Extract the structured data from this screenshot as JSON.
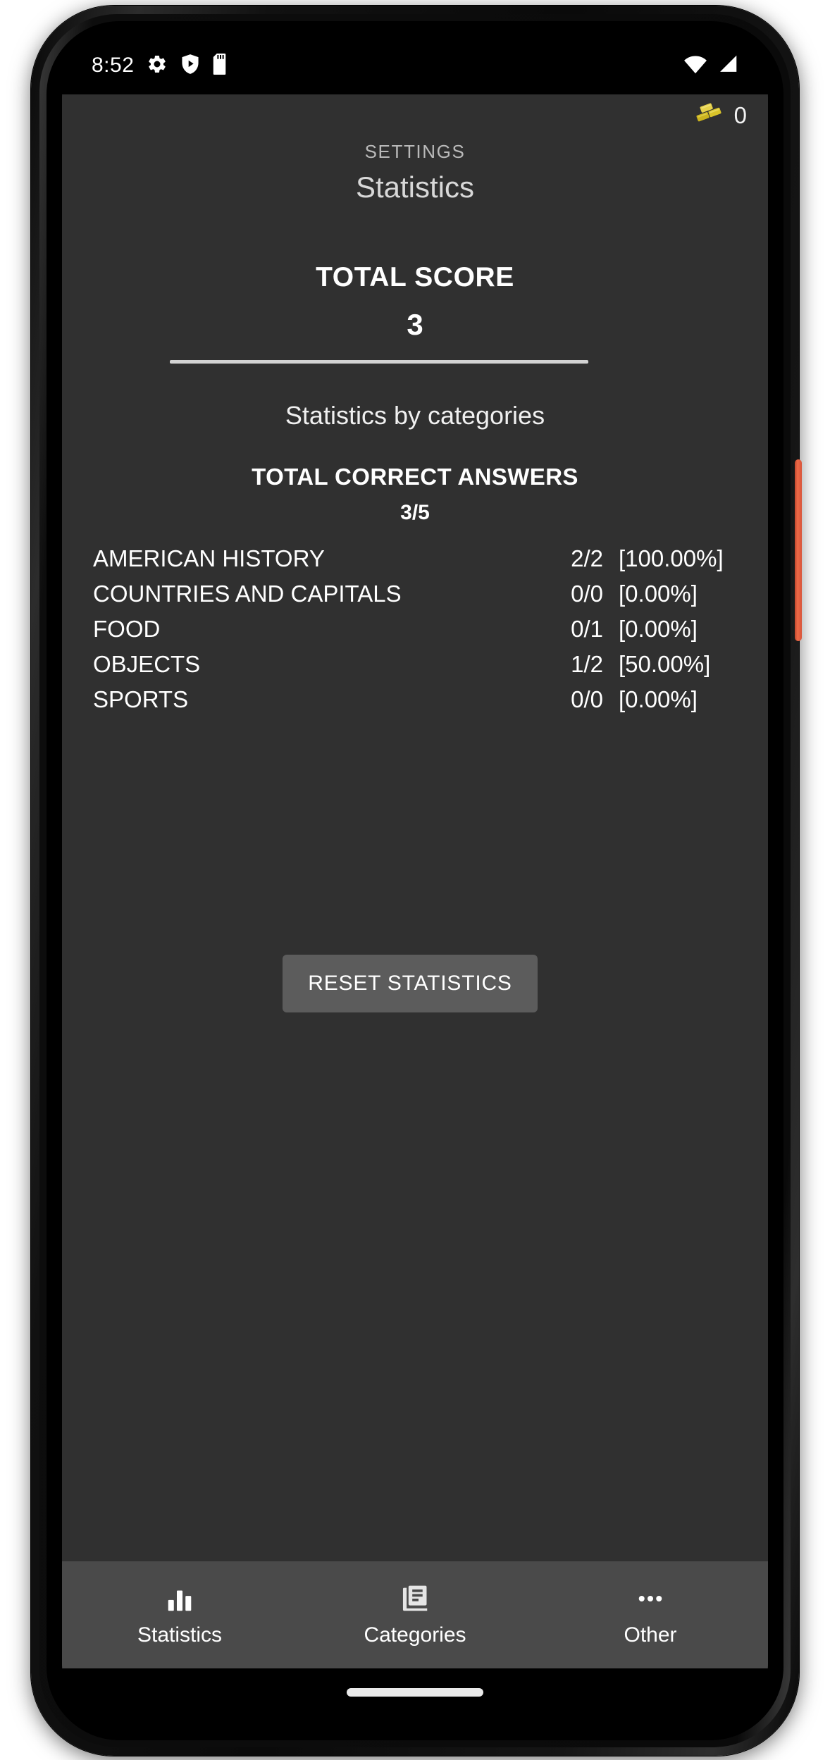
{
  "status_bar": {
    "time": "8:52",
    "left_icons": [
      "gear-icon",
      "shield-play-icon",
      "sd-card-icon"
    ],
    "right_icons": [
      "wifi-icon",
      "cellular-signal-icon"
    ]
  },
  "app": {
    "currency": {
      "icon": "gold-bars-icon",
      "count": "0",
      "color": "#d8c32a"
    },
    "header": {
      "eyebrow": "SETTINGS",
      "title": "Statistics"
    },
    "total_score": {
      "label": "TOTAL SCORE",
      "value": "3"
    },
    "section": {
      "subtitle": "Statistics by categories",
      "answers_label": "TOTAL CORRECT ANSWERS",
      "answers_value": "3/5"
    },
    "categories": [
      {
        "name": "AMERICAN HISTORY",
        "score": "2/2",
        "percent": "[100.00%]"
      },
      {
        "name": "COUNTRIES AND CAPITALS",
        "score": "0/0",
        "percent": "[0.00%]"
      },
      {
        "name": "FOOD",
        "score": "0/1",
        "percent": "[0.00%]"
      },
      {
        "name": "OBJECTS",
        "score": "1/2",
        "percent": "[50.00%]"
      },
      {
        "name": "SPORTS",
        "score": "0/0",
        "percent": "[0.00%]"
      }
    ],
    "reset_button": "RESET STATISTICS",
    "bottom_nav": [
      {
        "label": "Statistics",
        "icon": "bar-chart-icon",
        "selected": true
      },
      {
        "label": "Categories",
        "icon": "library-books-icon",
        "selected": false
      },
      {
        "label": "Other",
        "icon": "more-horizontal-icon",
        "selected": false
      }
    ]
  },
  "theme": {
    "app_background": "#303030",
    "nav_background": "#4a4a4a",
    "button_background": "#5c5c5c",
    "text_primary": "#ffffff",
    "text_secondary": "#b9b9b9",
    "power_button": "#ef6a47"
  }
}
